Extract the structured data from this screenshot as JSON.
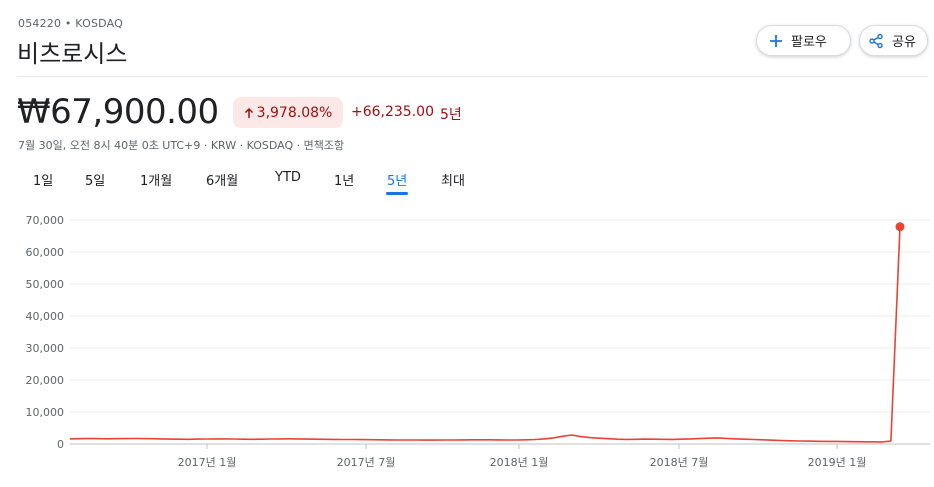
{
  "header": {
    "ticker": "054220 • KOSDAQ",
    "company": "비츠로시스",
    "follow_label": "팔로우",
    "share_label": "공유"
  },
  "quote": {
    "price": "₩67,900.00",
    "change_percent": "3,978.08%",
    "change_abs": "+66,235.00",
    "period": "5년",
    "meta": "7월 30일, 오전 8시 40분 0초 UTC+9 · KRW · KOSDAQ · ",
    "disclaimer": "면책조항"
  },
  "colors": {
    "negative": "#a50e0e",
    "line": "#ea4335",
    "accent": "#1a73e8"
  },
  "tabs": [
    {
      "label": "1일"
    },
    {
      "label": "5일"
    },
    {
      "label": "1개월"
    },
    {
      "label": "6개월"
    },
    {
      "label": "YTD"
    },
    {
      "label": "1년"
    },
    {
      "label": "5년",
      "active": true
    },
    {
      "label": "최대"
    }
  ],
  "icons": {
    "follow": "plus-icon",
    "share": "share-icon",
    "change": "arrow-up-icon"
  },
  "chart_data": {
    "type": "line",
    "ylim": [
      0,
      70000
    ],
    "yticks": [
      "70,000",
      "60,000",
      "50,000",
      "40,000",
      "30,000",
      "20,000",
      "10,000",
      "0"
    ],
    "xticks": [
      "2017년 1월",
      "2017년 7월",
      "2018년 1월",
      "2018년 7월",
      "2019년 1월"
    ],
    "grid": true,
    "series": [
      {
        "values": [
          1600,
          1650,
          1700,
          1680,
          1620,
          1650,
          1700,
          1720,
          1680,
          1650,
          1580,
          1520,
          1500,
          1480,
          1520,
          1560,
          1600,
          1580,
          1550,
          1500,
          1480,
          1500,
          1550,
          1600,
          1620,
          1580,
          1540,
          1500,
          1480,
          1450,
          1420,
          1400,
          1380,
          1350,
          1300,
          1280,
          1260,
          1250,
          1240,
          1230,
          1220,
          1240,
          1260,
          1280,
          1300,
          1320,
          1300,
          1280,
          1260,
          1250,
          1300,
          1400,
          1600,
          1900,
          2400,
          2800,
          2300,
          2000,
          1800,
          1650,
          1500,
          1450,
          1480,
          1520,
          1500,
          1470,
          1450,
          1500,
          1600,
          1700,
          1800,
          1900,
          1750,
          1600,
          1500,
          1400,
          1300,
          1200,
          1100,
          1000,
          950,
          900,
          850,
          820,
          800,
          760,
          720,
          700,
          680,
          660,
          900,
          67900
        ]
      }
    ],
    "last_value": 67900
  }
}
